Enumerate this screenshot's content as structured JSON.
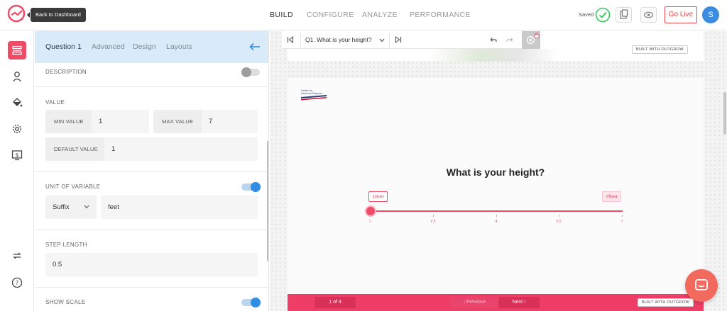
{
  "topbar": {
    "tooltip": "Back to Dashboard",
    "nav": [
      "BUILD",
      "CONFIGURE",
      "ANALYZE",
      "PERFORMANCE"
    ],
    "saved_label": "Saved",
    "golive_label": "Go Live",
    "avatar_initial": "S"
  },
  "panel": {
    "tabs": [
      "Question 1",
      "Advanced",
      "Design",
      "Layouts"
    ],
    "description_label": "DESCRIPTION",
    "value_label": "VALUE",
    "min_value_label": "MIN VALUE",
    "min_value": "1",
    "max_value_label": "MAX VALUE",
    "max_value": "7",
    "default_value_label": "DEFAULT VALUE",
    "default_value": "1",
    "unit_label": "UNIT OF VARIABLE",
    "unit_position": "Suffix",
    "unit_value": "feet",
    "step_label": "STEP LENGTH",
    "step_value": "0.5",
    "show_scale_label": "SHOW SCALE"
  },
  "canvas": {
    "question_selector": "Q1. What is your height?",
    "built_with_top": "BUILT WITH OUTGROW",
    "question_text": "What is your height?",
    "min_bubble": "1feet",
    "max_bubble": "7feet",
    "ticks": [
      "1",
      "2.5",
      "4",
      "5.5",
      "7"
    ],
    "slider_value": 1,
    "pager": "1 of 4",
    "previous_label": "Previous",
    "next_label": "Next",
    "built_with_bottom": "BUILT WITH OUTGROW",
    "brand_alt_text": "Center for American Progress"
  },
  "colors": {
    "accent": "#ee4b67",
    "toggle_on": "#2f8de4",
    "panel_header": "#d9ebf8",
    "golive": "#e5484d"
  }
}
